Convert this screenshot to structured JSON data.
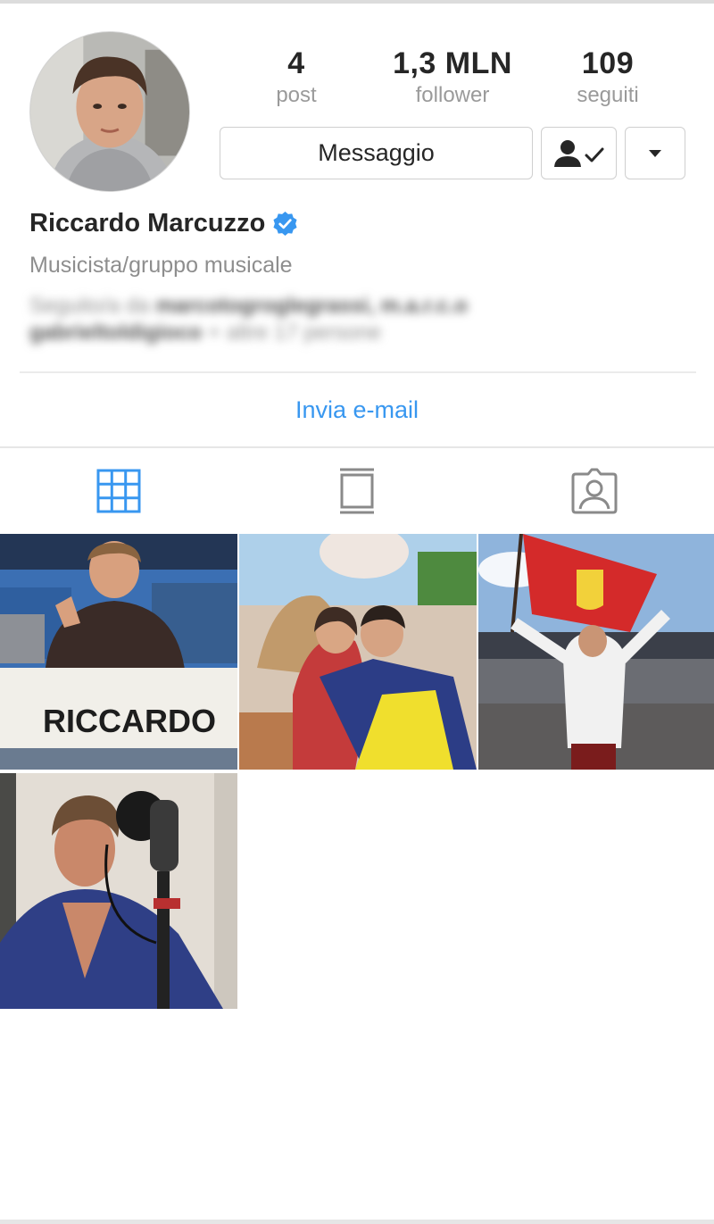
{
  "profile": {
    "name": "Riccardo Marcuzzo",
    "verified": true,
    "category": "Musicista/gruppo musicale",
    "followed_by": {
      "prefix": "Seguito/a da ",
      "names": "marcotogroglegrassi, m.a.r.c.o",
      "name_2": "gabrieltoldigioco",
      "suffix": " + altre 17 persone"
    }
  },
  "stats": [
    {
      "value": "4",
      "label": "post"
    },
    {
      "value": "1,3 MLN",
      "label": "follower"
    },
    {
      "value": "109",
      "label": "seguiti"
    }
  ],
  "actions": {
    "message_label": "Messaggio",
    "following_icon": "person-check-icon",
    "more_icon": "dropdown-triangle-icon",
    "email_label": "Invia e-mail"
  },
  "tabs": [
    {
      "icon": "grid-icon",
      "active": true
    },
    {
      "icon": "feed-icon",
      "active": false
    },
    {
      "icon": "tagged-icon",
      "active": false
    }
  ],
  "posts": [
    {
      "id": 1,
      "caption_text": "RICCARDO"
    },
    {
      "id": 2
    },
    {
      "id": 3
    },
    {
      "id": 4
    }
  ],
  "colors": {
    "accent": "#3897f0",
    "verified": "#3897f0",
    "text": "#262626",
    "muted": "#8e8e8e"
  }
}
